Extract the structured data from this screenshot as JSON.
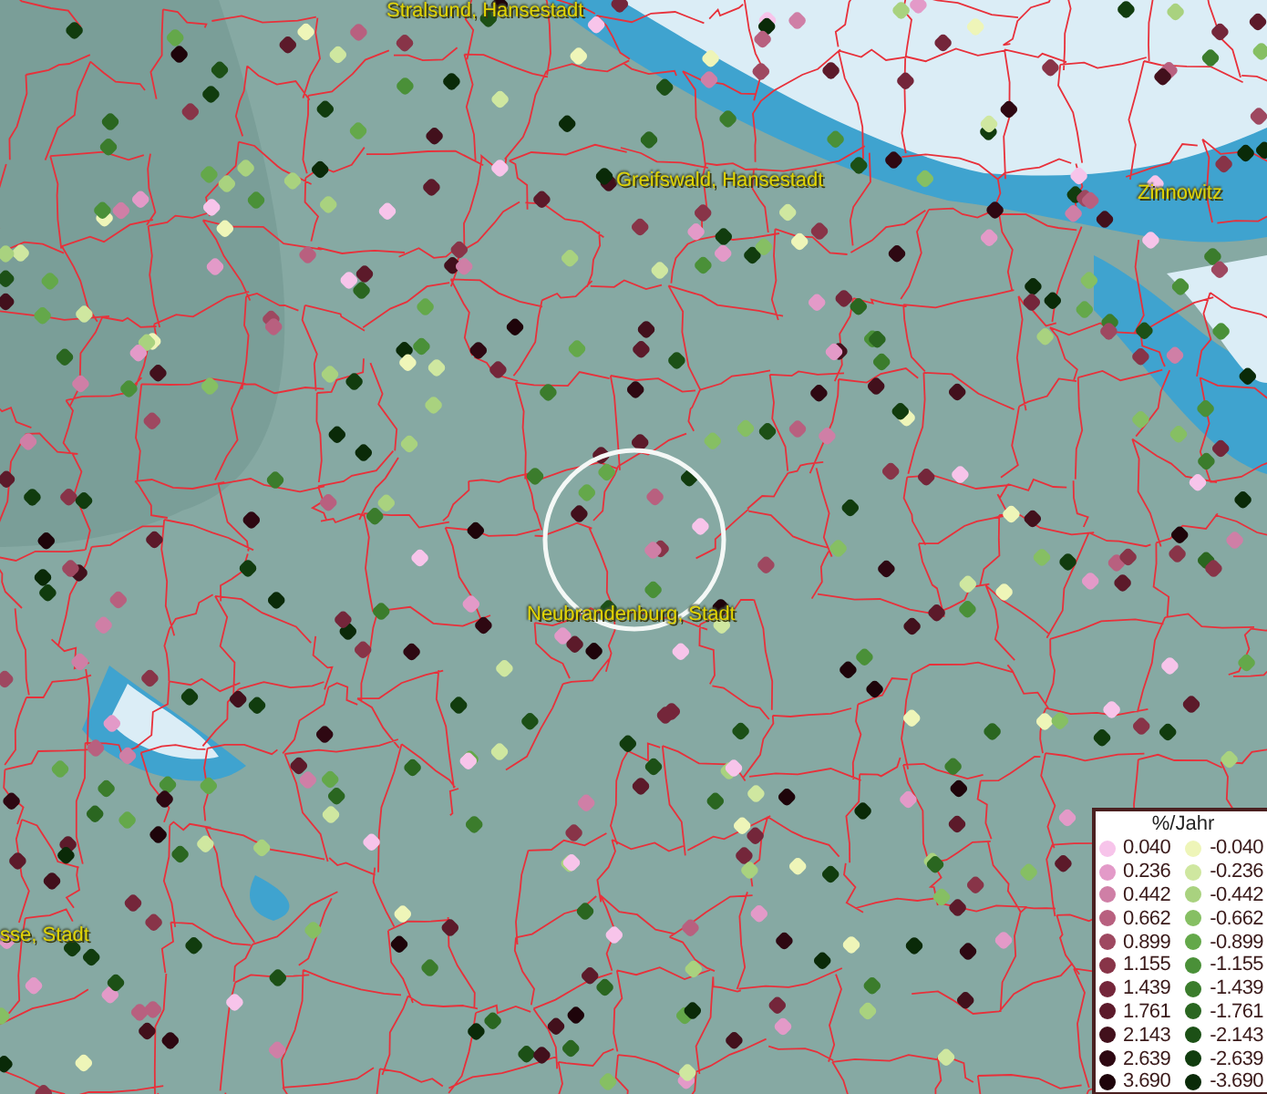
{
  "map": {
    "places": [
      {
        "label": "Stralsund, Hansestadt"
      },
      {
        "label": "Greifswald, Hansestadt"
      },
      {
        "label": "Zinnowitz"
      },
      {
        "label": "Neubrandenburg, Stadt"
      },
      {
        "label": "sse, Stadt"
      }
    ]
  },
  "legend": {
    "title": "%/Jahr",
    "columns": [
      {
        "entries": [
          {
            "label": "0.040",
            "color": "#f7c4ea"
          },
          {
            "label": "0.236",
            "color": "#e39ac8"
          },
          {
            "label": "0.442",
            "color": "#cf7fa6"
          },
          {
            "label": "0.662",
            "color": "#b8607f"
          },
          {
            "label": "0.899",
            "color": "#9e4860"
          },
          {
            "label": "1.155",
            "color": "#883448"
          },
          {
            "label": "1.439",
            "color": "#74263a"
          },
          {
            "label": "1.761",
            "color": "#5c1a2a"
          },
          {
            "label": "2.143",
            "color": "#42101c"
          },
          {
            "label": "2.639",
            "color": "#2e0812"
          },
          {
            "label": "3.690",
            "color": "#1e040a"
          }
        ]
      },
      {
        "entries": [
          {
            "label": "-0.040",
            "color": "#eef5b8"
          },
          {
            "label": "-0.236",
            "color": "#cfe7a0"
          },
          {
            "label": "-0.442",
            "color": "#a9d27f"
          },
          {
            "label": "-0.662",
            "color": "#86bf63"
          },
          {
            "label": "-0.899",
            "color": "#64a84a"
          },
          {
            "label": "-1.155",
            "color": "#4a9038"
          },
          {
            "label": "-1.439",
            "color": "#3b7c2c"
          },
          {
            "label": "-1.761",
            "color": "#2a6620"
          },
          {
            "label": "-2.143",
            "color": "#1c5016"
          },
          {
            "label": "-2.639",
            "color": "#113c0e"
          },
          {
            "label": "-3.690",
            "color": "#0a2a08"
          }
        ]
      }
    ]
  }
}
